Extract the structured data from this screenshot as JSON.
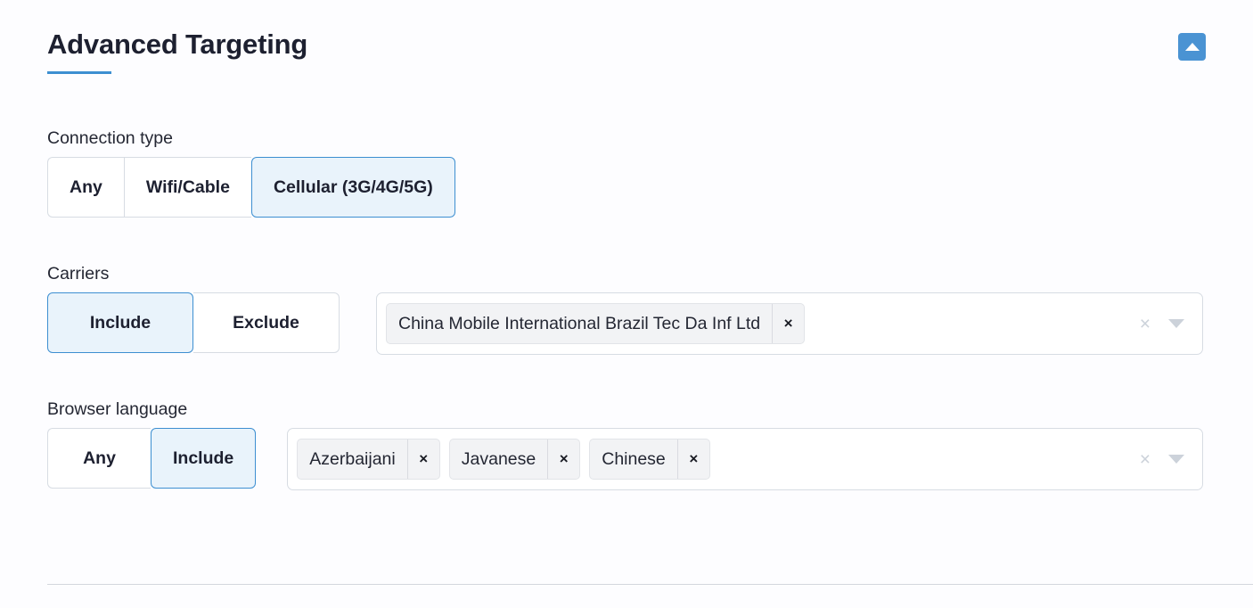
{
  "header": {
    "title": "Advanced Targeting",
    "collapse_button_label": "",
    "accent_color": "#3d8fd1"
  },
  "fields": {
    "connection_type": {
      "label": "Connection type",
      "options": [
        {
          "label": "Any",
          "selected": false
        },
        {
          "label": "Wifi/Cable",
          "selected": false
        },
        {
          "label": "Cellular (3G/4G/5G)",
          "selected": true
        }
      ],
      "selected_value": "Cellular (3G/4G/5G)"
    },
    "carriers": {
      "label": "Carriers",
      "options": [
        {
          "label": "Include",
          "selected": true
        },
        {
          "label": "Exclude",
          "selected": false
        }
      ],
      "selected_value": "Include",
      "tags": [
        {
          "label": "China Mobile International Brazil Tec Da Inf Ltd",
          "remove_label": "×"
        }
      ],
      "clear_label": "×",
      "placeholder": ""
    },
    "browser_language": {
      "label": "Browser language",
      "options": [
        {
          "label": "Any",
          "selected": false
        },
        {
          "label": "Include",
          "selected": true
        }
      ],
      "selected_value": "Include",
      "tags": [
        {
          "label": "Azerbaijani",
          "remove_label": "×"
        },
        {
          "label": "Javanese",
          "remove_label": "×"
        },
        {
          "label": "Chinese",
          "remove_label": "×"
        }
      ],
      "clear_label": "×",
      "placeholder": ""
    }
  },
  "colors": {
    "background": "#fdfdff",
    "selected_segment_fill": "#e9f3fb",
    "selected_segment_border": "#3d8fd1",
    "tag_fill": "#f2f3f5",
    "border": "#d7dce3",
    "text": "#242733"
  }
}
